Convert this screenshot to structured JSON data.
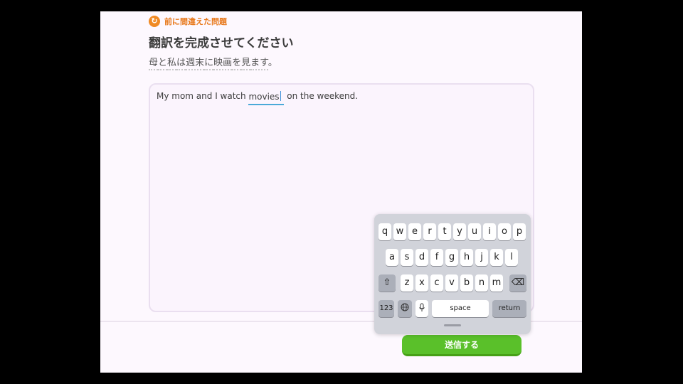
{
  "header": {
    "badge_icon": "refresh-icon",
    "badge_label": "前に間違えた問題",
    "title": "翻訳を完成させてください"
  },
  "prompt": {
    "words": [
      "母",
      "と",
      "私",
      "は",
      "週末",
      "に",
      "映画",
      "を",
      "見",
      "ます",
      "。"
    ]
  },
  "answer": {
    "before": "My mom and I watch ",
    "typed": "movies",
    "after": " on the weekend."
  },
  "submit_label": "送信する",
  "keyboard": {
    "row1": [
      "q",
      "w",
      "e",
      "r",
      "t",
      "y",
      "u",
      "i",
      "o",
      "p"
    ],
    "row2": [
      "a",
      "s",
      "d",
      "f",
      "g",
      "h",
      "j",
      "k",
      "l"
    ],
    "row3": [
      "z",
      "x",
      "c",
      "v",
      "b",
      "n",
      "m"
    ],
    "shift_icon": "shift-icon",
    "delete_icon": "backspace-icon",
    "numbers_label": "123",
    "globe_icon": "globe-icon",
    "mic_icon": "microphone-icon",
    "space_label": "space",
    "return_label": "return"
  },
  "colors": {
    "accent_orange": "#f08a24",
    "submit_green": "#5ac02a",
    "blank_underline": "#4aa9d8"
  }
}
